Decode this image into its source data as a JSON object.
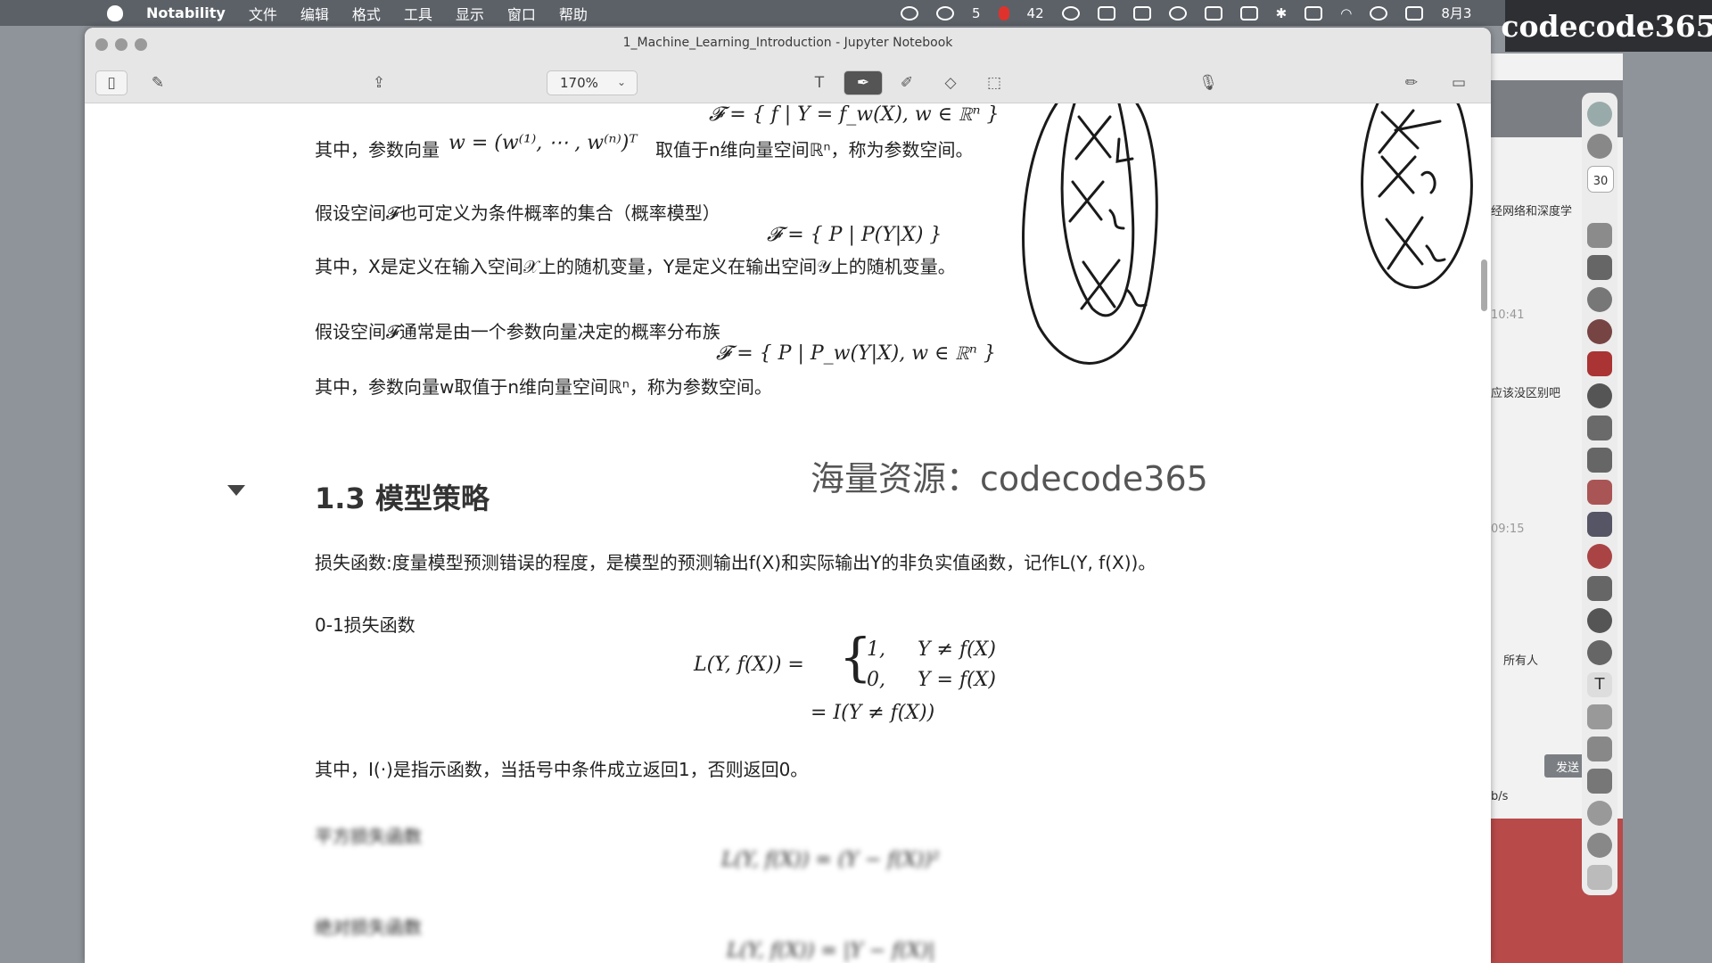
{
  "menubar": {
    "app_name": "Notability",
    "menus": [
      "文件",
      "编辑",
      "格式",
      "工具",
      "显示",
      "窗口",
      "帮助"
    ],
    "status": {
      "wechat_count": "5",
      "record_count": "42",
      "date": "8月3"
    }
  },
  "brand_overlay": "codecode365",
  "window": {
    "title": "1_Machine_Learning_Introduction - Jupyter Notebook",
    "zoom": "170%"
  },
  "background_app": {
    "items": [
      "经网络和深度学",
      "应该没区别吧",
      "所有人"
    ],
    "times": [
      "10:41",
      "09:15"
    ],
    "send": "发送",
    "speed": "b/s",
    "calendar_day": "30"
  },
  "content": {
    "line1_math": "𝓕 = { f | Y = f_w(X), w ∈ ℝⁿ }",
    "line2_prefix": "其中，参数向量",
    "line2_math": "w = (w⁽¹⁾, ⋯ , w⁽ⁿ⁾)ᵀ",
    "line2_suffix": "取值于n维向量空间ℝⁿ，称为参数空间。",
    "p3": "假设空间𝓕也可定义为条件概率的集合（概率模型）",
    "p3_math": "𝓕 = { P | P(Y|X) }",
    "p4": "其中，X是定义在输入空间𝒳上的随机变量，Y是定义在输出空间𝒴上的随机变量。",
    "p5": "假设空间𝓕通常是由一个参数向量决定的概率分布族",
    "p5_math": "𝓕 = { P | P_w(Y|X), w ∈ ℝⁿ }",
    "p6": "其中，参数向量w取值于n维向量空间ℝⁿ，称为参数空间。",
    "watermark": "海量资源：codecode365",
    "heading": "1.3 模型策略",
    "p7": "损失函数:度量模型预测错误的程度，是模型的预测输出f(X)和实际输出Y的非负实值函数，记作L(Y, f(X))。",
    "p8": "0-1损失函数",
    "eq_lhs": "L(Y, f(X)) =",
    "eq_case1_val": "1,",
    "eq_case1_cond": "Y ≠ f(X)",
    "eq_case2_val": "0,",
    "eq_case2_cond": "Y = f(X)",
    "eq_line2": "= I(Y ≠ f(X))",
    "p9": "其中，I(·)是指示函数，当括号中条件成立返回1，否则返回0。",
    "blur1_label": "平方损失函数",
    "blur1_math": "L(Y, f(X)) = (Y − f(X))²",
    "blur2_label": "绝对损失函数",
    "blur2_math": "L(Y, f(X)) = |Y − f(X)|"
  }
}
